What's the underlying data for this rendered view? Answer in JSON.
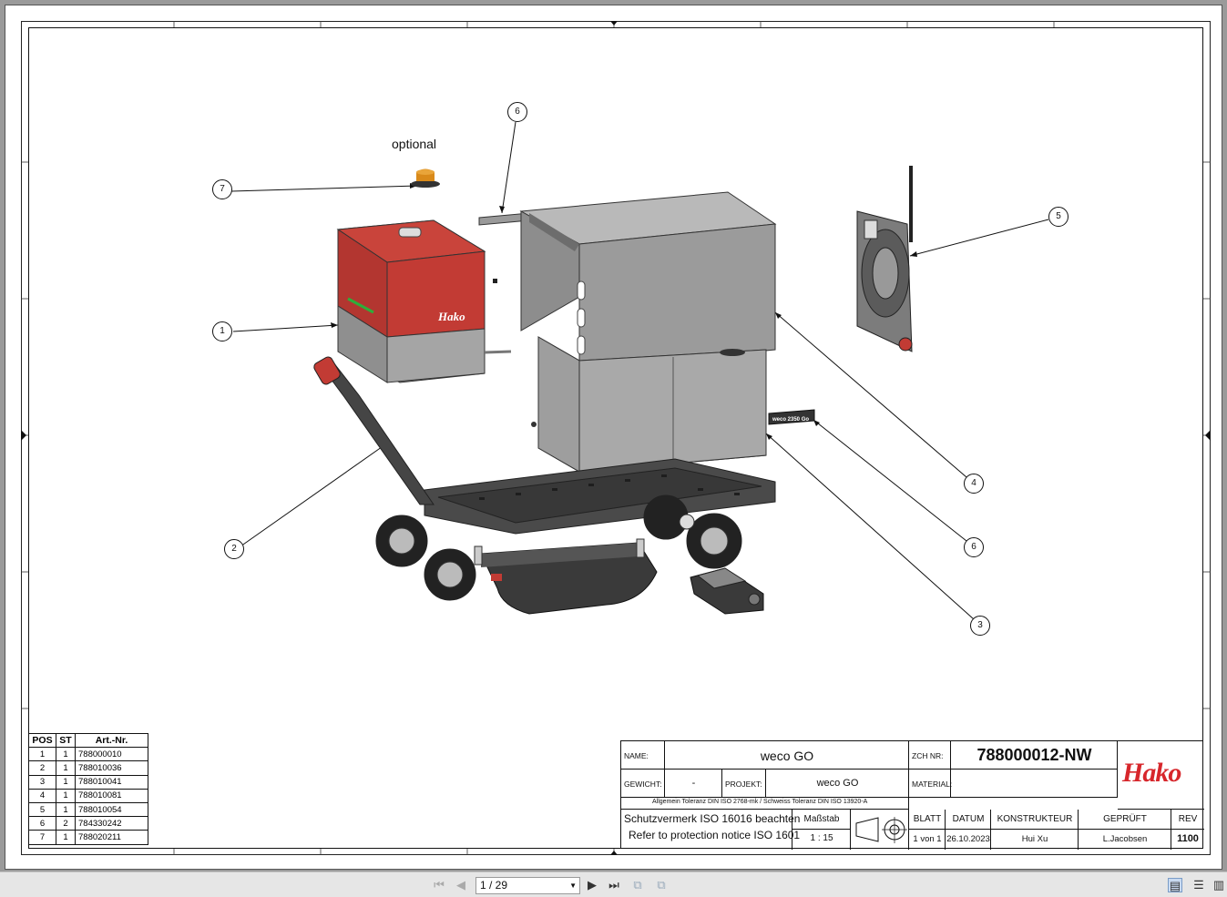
{
  "drawing": {
    "optional_label": "optional",
    "balloons": [
      "1",
      "2",
      "3",
      "4",
      "5",
      "6",
      "6",
      "7"
    ],
    "logo_text": "Hako",
    "label_plate_text": "weco 2350 Go"
  },
  "parts_list": {
    "headers": [
      "POS",
      "ST",
      "Art.-Nr."
    ],
    "rows": [
      [
        "1",
        "1",
        "788000010"
      ],
      [
        "2",
        "1",
        "788010036"
      ],
      [
        "3",
        "1",
        "788010041"
      ],
      [
        "4",
        "1",
        "788010081"
      ],
      [
        "5",
        "1",
        "788010054"
      ],
      [
        "6",
        "2",
        "784330242"
      ],
      [
        "7",
        "1",
        "788020211"
      ]
    ]
  },
  "title_block": {
    "name_label": "NAME:",
    "name_value": "weco GO",
    "zch_label": "ZCH NR:",
    "zch_value": "788000012-NW",
    "gewicht_label": "GEWICHT:",
    "gewicht_value": "-",
    "projekt_label": "PROJEKT:",
    "projekt_value": "weco GO",
    "material_label": "MATERIAL:",
    "material_value": "",
    "tolerance_note": "Allgemein Toleranz DIN ISO 2768-mk / Schweiss Toleranz DIN ISO 13920-A",
    "protection_de": "Schutzvermerk  ISO 16016 beachten",
    "protection_en": "Refer to protection notice ISO 1601",
    "massstab_label": "Maßstab",
    "massstab_value": "1 : 15",
    "blatt_label": "BLATT",
    "blatt_value": "1 von 1",
    "datum_label": "DATUM",
    "datum_value": "26.10.2023",
    "konstrukteur_label": "KONSTRUKTEUR",
    "konstrukteur_value": "Hui Xu",
    "geprueft_label": "GEPRÜFT",
    "geprueft_value": "L.Jacobsen",
    "rev_label": "REV",
    "rev_value": "1100",
    "logo": "Hako",
    "brand_color": "#d7262b"
  },
  "viewer": {
    "page_indicator": "1 / 29"
  }
}
